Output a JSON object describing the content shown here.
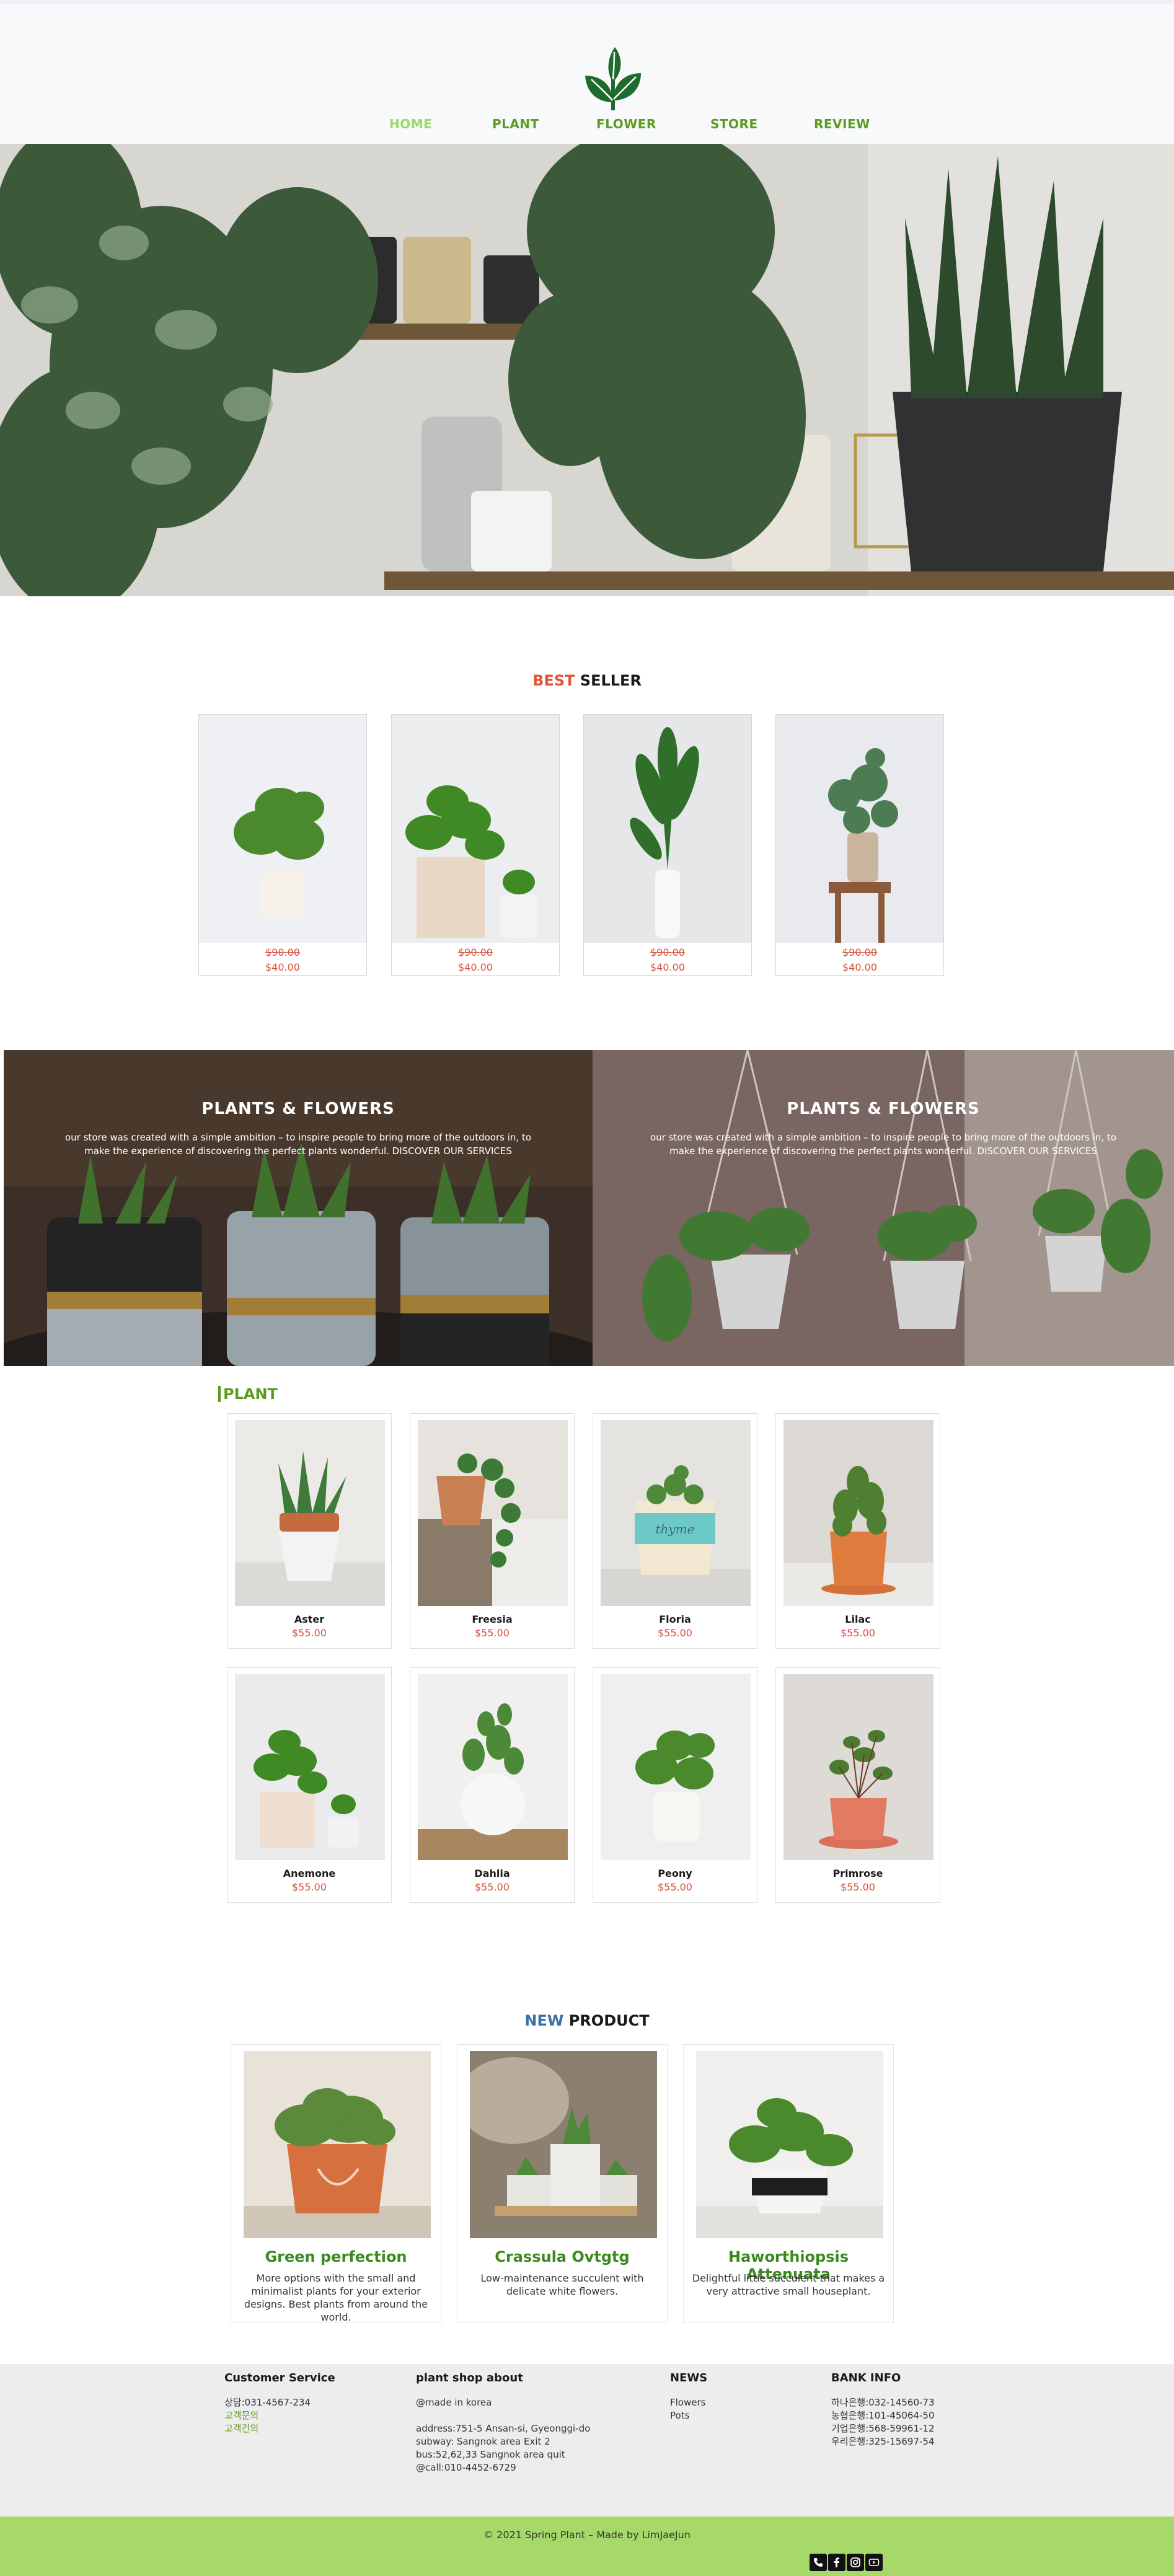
{
  "nav": {
    "items": [
      {
        "label": "HOME",
        "active": true
      },
      {
        "label": "PLANT",
        "active": false
      },
      {
        "label": "FLOWER",
        "active": false
      },
      {
        "label": "STORE",
        "active": false
      },
      {
        "label": "REVIEW",
        "active": false
      }
    ]
  },
  "best_seller": {
    "title_accent": "BEST",
    "title_rest": "SELLER",
    "products": [
      {
        "old_price": "$90.00",
        "new_price": "$40.00"
      },
      {
        "old_price": "$90.00",
        "new_price": "$40.00"
      },
      {
        "old_price": "$90.00",
        "new_price": "$40.00"
      },
      {
        "old_price": "$90.00",
        "new_price": "$40.00"
      }
    ]
  },
  "banners": [
    {
      "title": "PLANTS & FLOWERS",
      "text": "our store was created with a simple ambition – to inspire people to bring more of the outdoors in, to make the experience of discovering the perfect plants wonderful. DISCOVER OUR SERVICES"
    },
    {
      "title": "PLANTS & FLOWERS",
      "text": "our store was created with a simple ambition – to inspire people to bring more of the outdoors in, to make the experience of discovering the perfect plants wonderful. DISCOVER OUR SERVICES"
    }
  ],
  "plant_section": {
    "heading": "PLANT",
    "items": [
      {
        "name": "Aster",
        "price": "$55.00"
      },
      {
        "name": "Freesia",
        "price": "$55.00"
      },
      {
        "name": "Floria",
        "price": "$55.00"
      },
      {
        "name": "Lilac",
        "price": "$55.00"
      },
      {
        "name": "Anemone",
        "price": "$55.00"
      },
      {
        "name": "Dahlia",
        "price": "$55.00"
      },
      {
        "name": "Peony",
        "price": "$55.00"
      },
      {
        "name": "Primrose",
        "price": "$55.00"
      }
    ]
  },
  "new_product": {
    "title_accent": "NEW",
    "title_rest": "PRODUCT",
    "items": [
      {
        "name": "Green perfection",
        "desc": "More options with the small and minimalist plants for your exterior designs. Best plants from around the world."
      },
      {
        "name": "Crassula Ovtgtg",
        "desc": "Low-maintenance succulent with delicate white flowers."
      },
      {
        "name": "Haworthiopsis Attenuata",
        "desc": "Delightful little succulent that makes a very attractive small houseplant."
      }
    ]
  },
  "footer": {
    "customer_service": {
      "title": "Customer Service",
      "phone": "상담:031-4567-234",
      "links": [
        "고객문의",
        "고객건의"
      ]
    },
    "about": {
      "title": "plant shop about",
      "made": "@made in korea",
      "address": "address:751-5 Ansan-si, Gyeonggi-do",
      "subway": "subway: Sangnok area Exit 2",
      "bus": "bus:52,62,33 Sangnok area quit",
      "call": "@call:010-4452-6729"
    },
    "news": {
      "title": "NEWS",
      "items": [
        "Flowers",
        "Pots"
      ]
    },
    "bank": {
      "title": "BANK INFO",
      "items": [
        "하나은행:032-14560-73",
        "농협은행:101-45064-50",
        "기업은행:568-59961-12",
        "우리은행:325-15697-54"
      ]
    },
    "copyright": "© 2021 Spring Plant – Made by LimJaeJun",
    "social_icons": [
      "phone-icon",
      "facebook-icon",
      "instagram-icon",
      "youtube-icon"
    ]
  },
  "colors": {
    "brand_green": "#5c9b1f",
    "nav_active": "#9ad86a",
    "price_red": "#d9503a",
    "footer_bar": "#a6d96a",
    "new_accent": "#3a6fa8"
  }
}
